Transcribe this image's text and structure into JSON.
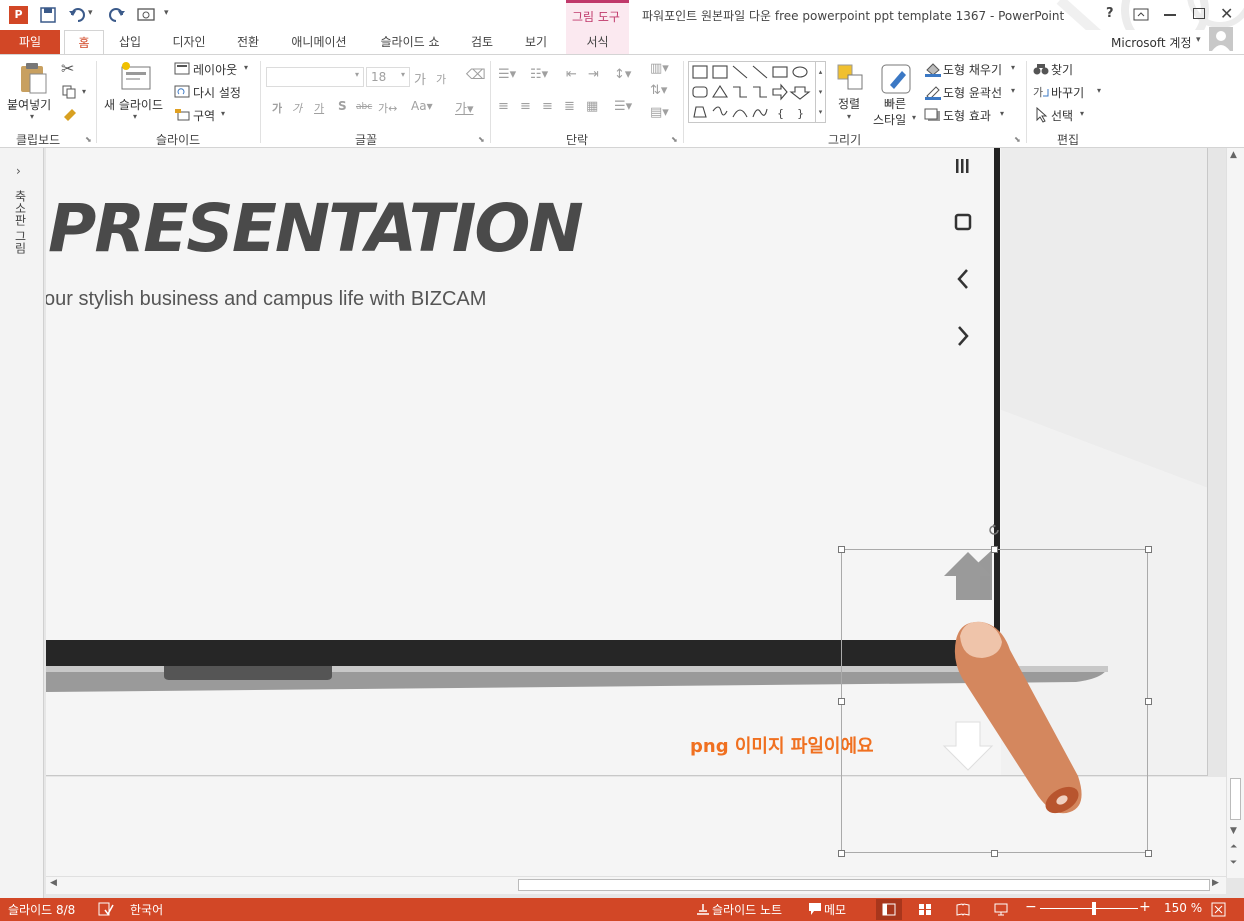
{
  "window": {
    "title": "파워포인트 원본파일 다운 free powerpoint ppt template 1367 - PowerPoint",
    "context_group": "그림 도구",
    "help": "?",
    "account": "Microsoft 계정"
  },
  "tabs": [
    "파일",
    "홈",
    "삽입",
    "디자인",
    "전환",
    "애니메이션",
    "슬라이드 쇼",
    "검토",
    "보기",
    "서식"
  ],
  "ribbon": {
    "clipboard": {
      "paste": "붙여넣기",
      "group": "클립보드"
    },
    "slides": {
      "new_slide": "새 슬라이드",
      "layout": "레이아웃",
      "reset": "다시 설정",
      "section": "구역",
      "group": "슬라이드"
    },
    "font": {
      "size": "18",
      "group": "글꼴"
    },
    "paragraph": {
      "group": "단락"
    },
    "drawing": {
      "arrange": "정렬",
      "quick_styles_1": "빠른",
      "quick_styles_2": "스타일",
      "fill": "도형 채우기",
      "outline": "도형 윤곽선",
      "effects": "도형 효과",
      "group": "그리기"
    },
    "editing": {
      "find": "찾기",
      "replace": "바꾸기",
      "select": "선택",
      "group": "편집"
    }
  },
  "left_panel": {
    "label": "축소판 그림"
  },
  "slide": {
    "heading": "PRESENTATION",
    "subtitle": "our stylish business and campus life with BIZCAM",
    "png_note": "png 이미지 파일이에요"
  },
  "status": {
    "slide": "슬라이드 8/8",
    "language": "한국어",
    "notes": "슬라이드 노트",
    "comments": "메모",
    "zoom": "150 %"
  },
  "colors": {
    "accent": "#d24726",
    "note": "#f07020",
    "heading": "#4a4a4a"
  }
}
